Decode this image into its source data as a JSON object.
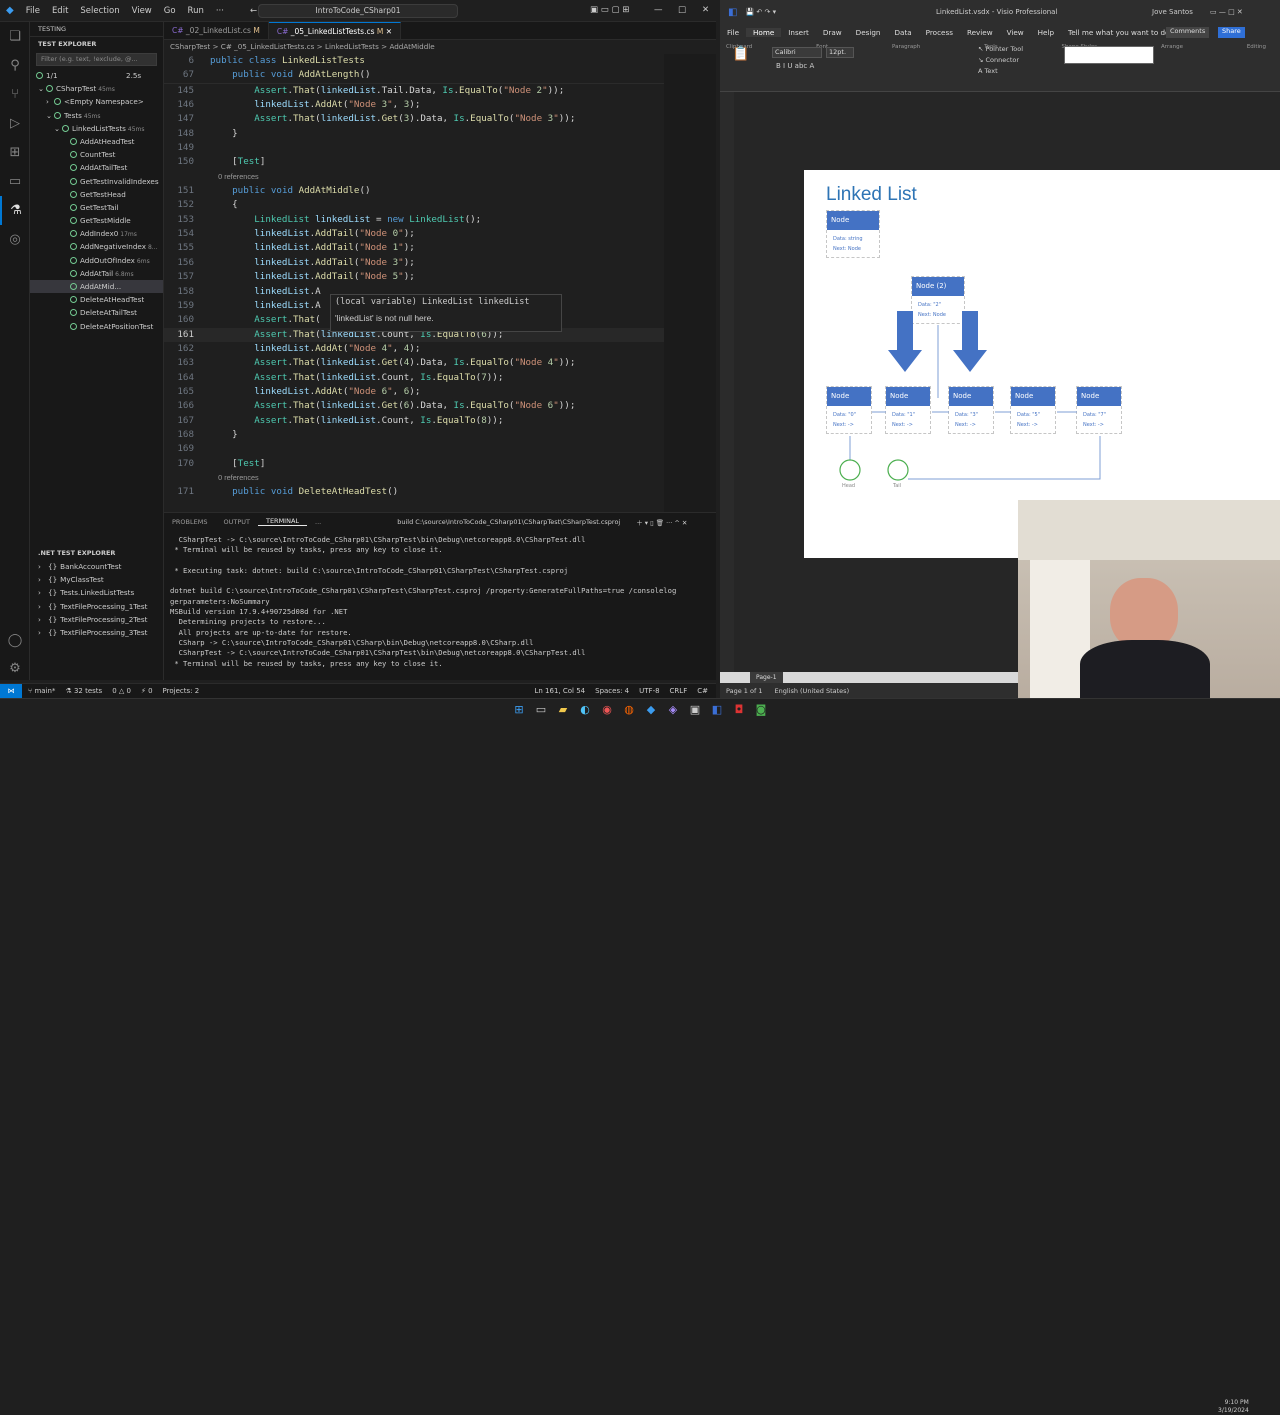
{
  "vscode": {
    "menu": [
      "File",
      "Edit",
      "Selection",
      "View",
      "Go",
      "Run"
    ],
    "search_text": "IntroToCode_CSharp01",
    "sidebar": {
      "title": "TESTING",
      "section": "TEST EXPLORER",
      "filter_placeholder": "Filter (e.g. text, !exclude, @...",
      "summary": "1/1",
      "summary_time": "2.5s",
      "tree": [
        {
          "label": "CSharpTest",
          "dur": "45ms",
          "indent": 1,
          "caret": "v"
        },
        {
          "label": "<Empty Namespace>",
          "dur": "",
          "indent": 2,
          "caret": ">"
        },
        {
          "label": "Tests",
          "dur": "45ms",
          "indent": 2,
          "caret": "v"
        },
        {
          "label": "LinkedListTests",
          "dur": "45ms",
          "indent": 3,
          "caret": "v"
        },
        {
          "label": "AddAtHeadTest",
          "dur": "",
          "indent": 4,
          "caret": ""
        },
        {
          "label": "CountTest",
          "dur": "",
          "indent": 4,
          "caret": ""
        },
        {
          "label": "AddAtTailTest",
          "dur": "",
          "indent": 4,
          "caret": ""
        },
        {
          "label": "GetTestInvalidIndexes",
          "dur": "",
          "indent": 4,
          "caret": ""
        },
        {
          "label": "GetTestHead",
          "dur": "",
          "indent": 4,
          "caret": ""
        },
        {
          "label": "GetTestTail",
          "dur": "",
          "indent": 4,
          "caret": ""
        },
        {
          "label": "GetTestMiddle",
          "dur": "",
          "indent": 4,
          "caret": ""
        },
        {
          "label": "AddIndex0",
          "dur": "17ms",
          "indent": 4,
          "caret": ""
        },
        {
          "label": "AddNegativeIndex",
          "dur": "8...",
          "indent": 4,
          "caret": ""
        },
        {
          "label": "AddOutOfIndex",
          "dur": "6ms",
          "indent": 4,
          "caret": ""
        },
        {
          "label": "AddAtTail",
          "dur": "6.8ms",
          "indent": 4,
          "caret": ""
        },
        {
          "label": "AddAtMid...",
          "dur": "",
          "indent": 4,
          "caret": ""
        },
        {
          "label": "DeleteAtHeadTest",
          "dur": "",
          "indent": 4,
          "caret": ""
        },
        {
          "label": "DeleteAtTailTest",
          "dur": "",
          "indent": 4,
          "caret": ""
        },
        {
          "label": "DeleteAtPositionTest",
          "dur": "",
          "indent": 4,
          "caret": ""
        }
      ],
      "net_title": ".NET TEST EXPLORER",
      "net_items": [
        "BankAccountTest",
        "MyClassTest",
        "Tests.LinkedListTests",
        "TextFileProcessing_1Test",
        "TextFileProcessing_2Test",
        "TextFileProcessing_3Test"
      ]
    },
    "tabs": [
      {
        "label": "_02_LinkedList.cs",
        "badge": "M"
      },
      {
        "label": "_05_LinkedListTests.cs",
        "badge": "M"
      }
    ],
    "breadcrumb": "CSharpTest > C# _05_LinkedListTests.cs > LinkedListTests > AddAtMiddle",
    "code": [
      {
        "n": "145",
        "t": "        Assert.That(linkedList.Tail.Data, Is.EqualTo(\"Node 2\"));"
      },
      {
        "n": "146",
        "t": "        linkedList.AddAt(\"Node 3\", 3);"
      },
      {
        "n": "147",
        "t": "        Assert.That(linkedList.Get(3).Data, Is.EqualTo(\"Node 3\"));"
      },
      {
        "n": "148",
        "t": "    }"
      },
      {
        "n": "149",
        "t": ""
      },
      {
        "n": "150",
        "t": "    [Test]"
      },
      {
        "n": "",
        "t": "    0 references",
        "ref": true
      },
      {
        "n": "151",
        "t": "    public void AddAtMiddle()"
      },
      {
        "n": "152",
        "t": "    {"
      },
      {
        "n": "153",
        "t": "        LinkedList linkedList = new LinkedList();"
      },
      {
        "n": "154",
        "t": "        linkedList.AddTail(\"Node 0\");"
      },
      {
        "n": "155",
        "t": "        linkedList.AddTail(\"Node 1\");"
      },
      {
        "n": "156",
        "t": "        linkedList.AddTail(\"Node 3\");"
      },
      {
        "n": "157",
        "t": "        linkedList.AddTail(\"Node 5\");"
      },
      {
        "n": "158",
        "t": "        linkedList.A"
      },
      {
        "n": "159",
        "t": "        linkedList.A"
      },
      {
        "n": "160",
        "t": "        Assert.That(                                    2\"));"
      },
      {
        "n": "161",
        "t": "        Assert.That(linkedList.Count, Is.EqualTo(6));",
        "cur": true
      },
      {
        "n": "162",
        "t": "        linkedList.AddAt(\"Node 4\", 4);"
      },
      {
        "n": "163",
        "t": "        Assert.That(linkedList.Get(4).Data, Is.EqualTo(\"Node 4\"));"
      },
      {
        "n": "164",
        "t": "        Assert.That(linkedList.Count, Is.EqualTo(7));"
      },
      {
        "n": "165",
        "t": "        linkedList.AddAt(\"Node 6\", 6);"
      },
      {
        "n": "166",
        "t": "        Assert.That(linkedList.Get(6).Data, Is.EqualTo(\"Node 6\"));"
      },
      {
        "n": "167",
        "t": "        Assert.That(linkedList.Count, Is.EqualTo(8));"
      },
      {
        "n": "168",
        "t": "    }"
      },
      {
        "n": "169",
        "t": ""
      },
      {
        "n": "170",
        "t": "    [Test]"
      },
      {
        "n": "",
        "t": "    0 references",
        "ref": true
      },
      {
        "n": "171",
        "t": "    public void DeleteAtHeadTest()"
      }
    ],
    "sticky": [
      {
        "n": "6",
        "t": "public class LinkedListTests"
      },
      {
        "n": "67",
        "t": "    public void AddAtLength()"
      }
    ],
    "hover_line1": "(local variable) LinkedList linkedList",
    "hover_line2": "'linkedList' is not null here.",
    "panel_tabs": [
      "PROBLEMS",
      "OUTPUT",
      "TERMINAL",
      "..."
    ],
    "terminal_title": "build C:\\source\\IntroToCode_CSharp01\\CSharpTest\\CSharpTest.csproj",
    "terminal": [
      "  CSharpTest -> C:\\source\\IntroToCode_CSharp01\\CSharpTest\\bin\\Debug\\netcoreapp8.0\\CSharpTest.dll",
      " * Terminal will be reused by tasks, press any key to close it.",
      "",
      " * Executing task: dotnet: build C:\\source\\IntroToCode_CSharp01\\CSharpTest\\CSharpTest.csproj",
      "",
      "dotnet build C:\\source\\IntroToCode_CSharp01\\CSharpTest\\CSharpTest.csproj /property:GenerateFullPaths=true /consolelog",
      "gerparameters:NoSummary",
      "MSBuild version 17.9.4+90725d08d for .NET",
      "  Determining projects to restore...",
      "  All projects are up-to-date for restore.",
      "  CSharp -> C:\\source\\IntroToCode_CSharp01\\CSharp\\bin\\Debug\\netcoreapp8.0\\CSharp.dll",
      "  CSharpTest -> C:\\source\\IntroToCode_CSharp01\\CSharpTest\\bin\\Debug\\netcoreapp8.0\\CSharpTest.dll",
      " * Terminal will be reused by tasks, press any key to close it."
    ],
    "status": {
      "branch": "main*",
      "tests": "32 tests",
      "problems": "0 △ 0",
      "ports": "0",
      "projects": "Projects: 2",
      "position": "Ln 161, Col 54",
      "spaces": "Spaces: 4",
      "encoding": "UTF-8",
      "eol": "CRLF",
      "lang": "C#"
    }
  },
  "visio": {
    "title": "LinkedList.vsdx  -  Visio Professional",
    "user": "Jove Santos",
    "menu": [
      "File",
      "Home",
      "Insert",
      "Draw",
      "Design",
      "Data",
      "Process",
      "Review",
      "View",
      "Help",
      "Tell me what you want to do"
    ],
    "comments": "Comments",
    "share": "Share",
    "font": "Calibri",
    "size": "12pt.",
    "ribbon_groups": [
      "Clipboard",
      "Font",
      "Paragraph",
      "Tools",
      "Shape Styles",
      "Arrange",
      "Editing"
    ],
    "tools": [
      "Pointer Tool",
      "Connector",
      "Text"
    ],
    "diagram": {
      "title": "Linked List",
      "template": {
        "header": "Node",
        "line1": "Data: string",
        "line2": "Next: Node"
      },
      "new_node": {
        "header": "Node (2)",
        "line1": "Data: \"2\"",
        "line2": "Next: Node"
      },
      "nodes": [
        {
          "header": "Node",
          "line1": "Data: \"0\"",
          "line2": "Next: ->"
        },
        {
          "header": "Node",
          "line1": "Data: \"1\"",
          "line2": "Next: ->"
        },
        {
          "header": "Node",
          "line1": "Data: \"3\"",
          "line2": "Next: ->"
        },
        {
          "header": "Node",
          "line1": "Data: \"5\"",
          "line2": "Next: ->"
        },
        {
          "header": "Node",
          "line1": "Data: \"7\"",
          "line2": "Next: ->"
        }
      ],
      "head_label": "Head",
      "tail_label": "Tail"
    },
    "page_tab": "Page-1",
    "status": "Page 1 of 1",
    "language": "English (United States)"
  },
  "taskbar": {
    "time": "9:10 PM",
    "date": "3/19/2024"
  }
}
